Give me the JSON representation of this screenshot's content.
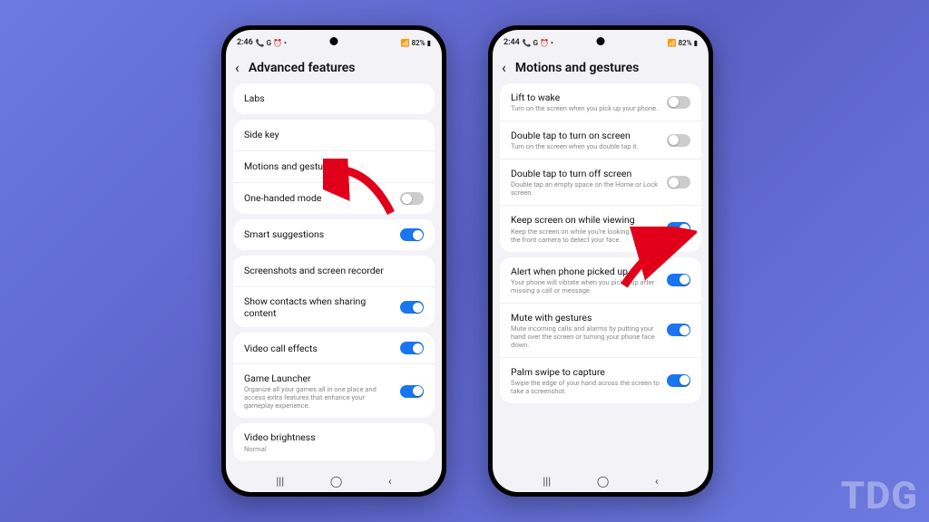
{
  "watermark": "TDG",
  "phones": {
    "left": {
      "status": {
        "time": "2:46",
        "icons": "📞 G ⏰ •",
        "battery": "82%",
        "signal": "📶"
      },
      "title": "Advanced features",
      "groups": [
        [
          {
            "title": "Labs",
            "sub": "",
            "toggle": null
          }
        ],
        [
          {
            "title": "Side key",
            "sub": "",
            "toggle": null
          },
          {
            "title": "Motions and gestures",
            "sub": "",
            "toggle": null
          },
          {
            "title": "One-handed mode",
            "sub": "",
            "toggle": "off"
          }
        ],
        [
          {
            "title": "Smart suggestions",
            "sub": "",
            "toggle": "on"
          }
        ],
        [
          {
            "title": "Screenshots and screen recorder",
            "sub": "",
            "toggle": null
          },
          {
            "title": "Show contacts when sharing content",
            "sub": "",
            "toggle": "on"
          }
        ],
        [
          {
            "title": "Video call effects",
            "sub": "",
            "toggle": "on"
          },
          {
            "title": "Game Launcher",
            "sub": "Organize all your games all in one place and access extra features that enhance your gameplay experience.",
            "toggle": "on"
          }
        ],
        [
          {
            "title": "Video brightness",
            "sub": "Normal",
            "toggle": null
          }
        ]
      ]
    },
    "right": {
      "status": {
        "time": "2:44",
        "icons": "📞 G ⏰ •",
        "battery": "82%",
        "signal": "📶"
      },
      "title": "Motions and gestures",
      "groups": [
        [
          {
            "title": "Lift to wake",
            "sub": "Turn on the screen when you pick up your phone.",
            "toggle": "off"
          },
          {
            "title": "Double tap to turn on screen",
            "sub": "Turn on the screen when you double tap it.",
            "toggle": "off"
          },
          {
            "title": "Double tap to turn off screen",
            "sub": "Double tap an empty space on the Home or Lock screen.",
            "toggle": "off"
          },
          {
            "title": "Keep screen on while viewing",
            "sub": "Keep the screen on while you're looking at it using the front camera to detect your face.",
            "toggle": "on"
          }
        ],
        [
          {
            "title": "Alert when phone picked up",
            "sub": "Your phone will vibrate when you pick it up after missing a call or message.",
            "toggle": "on"
          },
          {
            "title": "Mute with gestures",
            "sub": "Mute incoming calls and alarms by putting your hand over the screen or turning your phone face down.",
            "toggle": "on"
          },
          {
            "title": "Palm swipe to capture",
            "sub": "Swipe the edge of your hand across the screen to take a screenshot.",
            "toggle": "on"
          }
        ]
      ]
    }
  }
}
